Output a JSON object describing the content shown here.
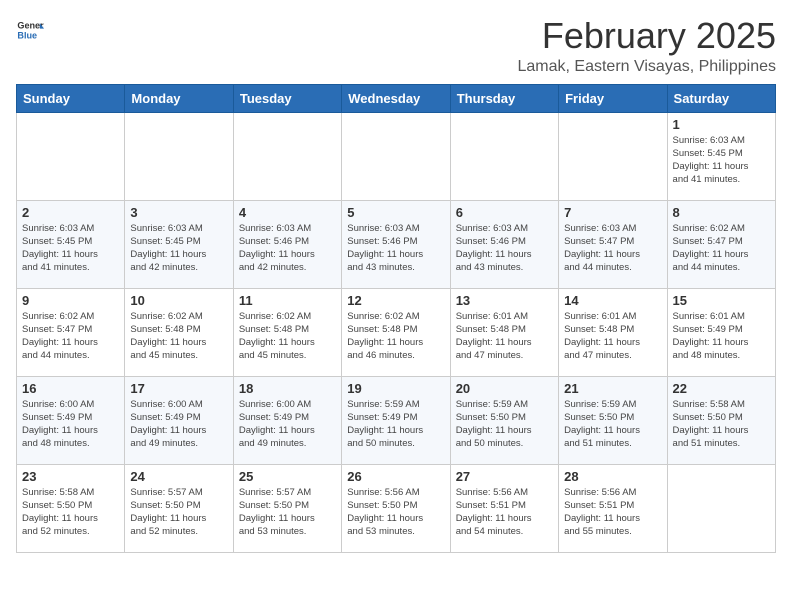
{
  "header": {
    "logo_general": "General",
    "logo_blue": "Blue",
    "month_year": "February 2025",
    "location": "Lamak, Eastern Visayas, Philippines"
  },
  "weekdays": [
    "Sunday",
    "Monday",
    "Tuesday",
    "Wednesday",
    "Thursday",
    "Friday",
    "Saturday"
  ],
  "weeks": [
    [
      {
        "day": "",
        "info": ""
      },
      {
        "day": "",
        "info": ""
      },
      {
        "day": "",
        "info": ""
      },
      {
        "day": "",
        "info": ""
      },
      {
        "day": "",
        "info": ""
      },
      {
        "day": "",
        "info": ""
      },
      {
        "day": "1",
        "info": "Sunrise: 6:03 AM\nSunset: 5:45 PM\nDaylight: 11 hours\nand 41 minutes."
      }
    ],
    [
      {
        "day": "2",
        "info": "Sunrise: 6:03 AM\nSunset: 5:45 PM\nDaylight: 11 hours\nand 41 minutes."
      },
      {
        "day": "3",
        "info": "Sunrise: 6:03 AM\nSunset: 5:45 PM\nDaylight: 11 hours\nand 42 minutes."
      },
      {
        "day": "4",
        "info": "Sunrise: 6:03 AM\nSunset: 5:46 PM\nDaylight: 11 hours\nand 42 minutes."
      },
      {
        "day": "5",
        "info": "Sunrise: 6:03 AM\nSunset: 5:46 PM\nDaylight: 11 hours\nand 43 minutes."
      },
      {
        "day": "6",
        "info": "Sunrise: 6:03 AM\nSunset: 5:46 PM\nDaylight: 11 hours\nand 43 minutes."
      },
      {
        "day": "7",
        "info": "Sunrise: 6:03 AM\nSunset: 5:47 PM\nDaylight: 11 hours\nand 44 minutes."
      },
      {
        "day": "8",
        "info": "Sunrise: 6:02 AM\nSunset: 5:47 PM\nDaylight: 11 hours\nand 44 minutes."
      }
    ],
    [
      {
        "day": "9",
        "info": "Sunrise: 6:02 AM\nSunset: 5:47 PM\nDaylight: 11 hours\nand 44 minutes."
      },
      {
        "day": "10",
        "info": "Sunrise: 6:02 AM\nSunset: 5:48 PM\nDaylight: 11 hours\nand 45 minutes."
      },
      {
        "day": "11",
        "info": "Sunrise: 6:02 AM\nSunset: 5:48 PM\nDaylight: 11 hours\nand 45 minutes."
      },
      {
        "day": "12",
        "info": "Sunrise: 6:02 AM\nSunset: 5:48 PM\nDaylight: 11 hours\nand 46 minutes."
      },
      {
        "day": "13",
        "info": "Sunrise: 6:01 AM\nSunset: 5:48 PM\nDaylight: 11 hours\nand 47 minutes."
      },
      {
        "day": "14",
        "info": "Sunrise: 6:01 AM\nSunset: 5:48 PM\nDaylight: 11 hours\nand 47 minutes."
      },
      {
        "day": "15",
        "info": "Sunrise: 6:01 AM\nSunset: 5:49 PM\nDaylight: 11 hours\nand 48 minutes."
      }
    ],
    [
      {
        "day": "16",
        "info": "Sunrise: 6:00 AM\nSunset: 5:49 PM\nDaylight: 11 hours\nand 48 minutes."
      },
      {
        "day": "17",
        "info": "Sunrise: 6:00 AM\nSunset: 5:49 PM\nDaylight: 11 hours\nand 49 minutes."
      },
      {
        "day": "18",
        "info": "Sunrise: 6:00 AM\nSunset: 5:49 PM\nDaylight: 11 hours\nand 49 minutes."
      },
      {
        "day": "19",
        "info": "Sunrise: 5:59 AM\nSunset: 5:49 PM\nDaylight: 11 hours\nand 50 minutes."
      },
      {
        "day": "20",
        "info": "Sunrise: 5:59 AM\nSunset: 5:50 PM\nDaylight: 11 hours\nand 50 minutes."
      },
      {
        "day": "21",
        "info": "Sunrise: 5:59 AM\nSunset: 5:50 PM\nDaylight: 11 hours\nand 51 minutes."
      },
      {
        "day": "22",
        "info": "Sunrise: 5:58 AM\nSunset: 5:50 PM\nDaylight: 11 hours\nand 51 minutes."
      }
    ],
    [
      {
        "day": "23",
        "info": "Sunrise: 5:58 AM\nSunset: 5:50 PM\nDaylight: 11 hours\nand 52 minutes."
      },
      {
        "day": "24",
        "info": "Sunrise: 5:57 AM\nSunset: 5:50 PM\nDaylight: 11 hours\nand 52 minutes."
      },
      {
        "day": "25",
        "info": "Sunrise: 5:57 AM\nSunset: 5:50 PM\nDaylight: 11 hours\nand 53 minutes."
      },
      {
        "day": "26",
        "info": "Sunrise: 5:56 AM\nSunset: 5:50 PM\nDaylight: 11 hours\nand 53 minutes."
      },
      {
        "day": "27",
        "info": "Sunrise: 5:56 AM\nSunset: 5:51 PM\nDaylight: 11 hours\nand 54 minutes."
      },
      {
        "day": "28",
        "info": "Sunrise: 5:56 AM\nSunset: 5:51 PM\nDaylight: 11 hours\nand 55 minutes."
      },
      {
        "day": "",
        "info": ""
      }
    ]
  ]
}
